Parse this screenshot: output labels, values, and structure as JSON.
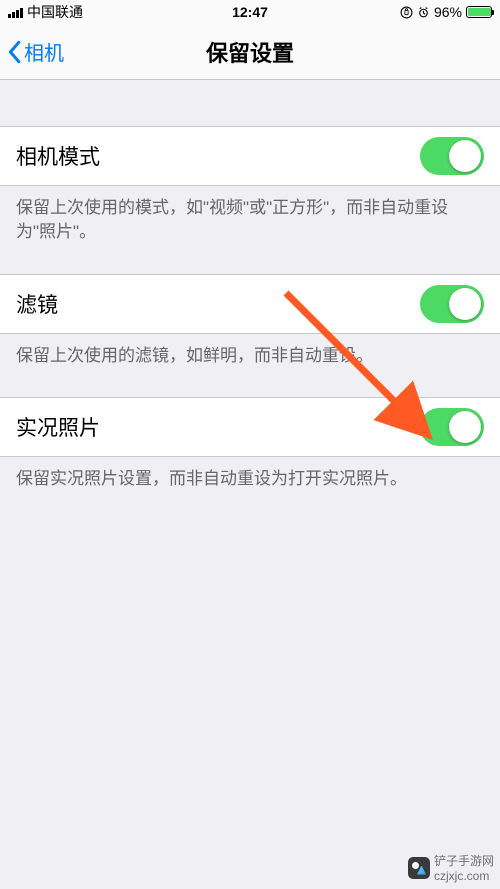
{
  "status": {
    "carrier": "中国联通",
    "time": "12:47",
    "battery_pct": "96%"
  },
  "nav": {
    "back_label": "相机",
    "title": "保留设置"
  },
  "settings": [
    {
      "label": "相机模式",
      "on": true,
      "footer": "保留上次使用的模式，如\"视频\"或\"正方形\"，而非自动重设为\"照片\"。"
    },
    {
      "label": "滤镜",
      "on": true,
      "footer": "保留上次使用的滤镜，如鲜明，而非自动重设。"
    },
    {
      "label": "实况照片",
      "on": true,
      "footer": "保留实况照片设置，而非自动重设为打开实况照片。"
    }
  ],
  "watermark": {
    "brand": "铲子手游网",
    "url": "czjxjc.com"
  },
  "colors": {
    "ios_green": "#4cd964",
    "ios_blue": "#007aff",
    "arrow": "#ff5a24"
  }
}
